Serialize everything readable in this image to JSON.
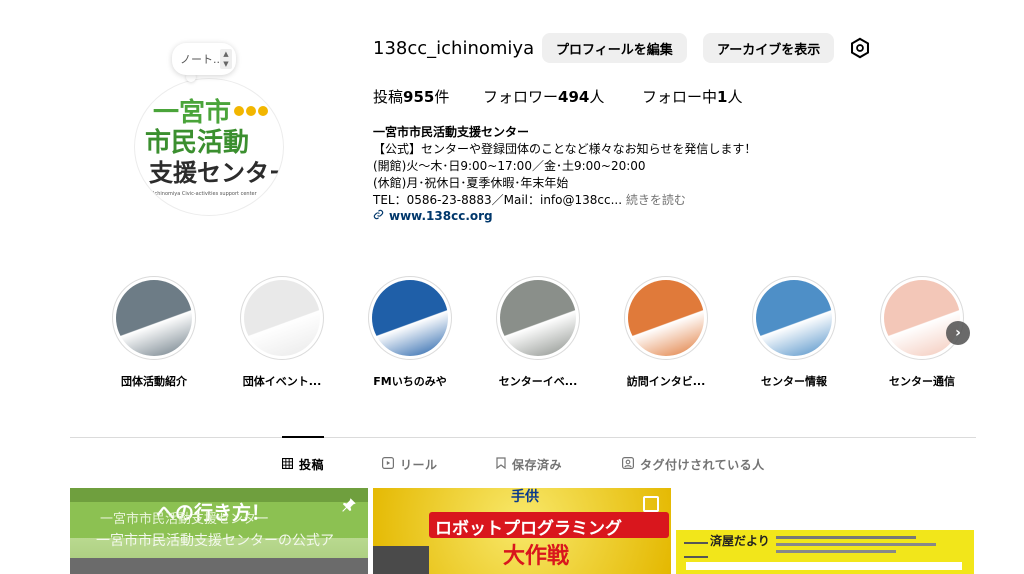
{
  "profile": {
    "username": "138cc_ichinomiya",
    "edit_profile_label": "プロフィールを編集",
    "archive_label": "アーカイブを表示",
    "note_text": "ノート...",
    "avatar_logo_lines": [
      "一宮市",
      "市民活動",
      "支援センター"
    ],
    "avatar_logo_caption": "Ichinomiya Civic-activities support center"
  },
  "stats": {
    "posts_label": "投稿",
    "posts_count": "955",
    "posts_suffix": "件",
    "followers_label": "フォロワー",
    "followers_count": "494",
    "followers_suffix": "人",
    "following_label": "フォロー中",
    "following_count": "1",
    "following_suffix": "人"
  },
  "bio": {
    "name": "一宮市市民活動支援センター",
    "line1": "【公式】センターや登録団体のことなど様々なお知らせを発信します！",
    "line2": "(開館)火～木･日9:00~17:00／金･土9:00~20:00",
    "line3": "(休館)月･祝休日･夏季休暇･年末年始",
    "line4": "TEL：0586-23-8883／Mail：info@138cc...",
    "more": "続きを読む",
    "link": "www.138cc.org"
  },
  "highlights": [
    {
      "label": "団体活動紹介",
      "color": "#6d7c86"
    },
    {
      "label": "団体イベント...",
      "color": "#e9e9e9"
    },
    {
      "label": "FMいちのみや",
      "color": "#1f5fa8"
    },
    {
      "label": "センターイベ...",
      "color": "#8a8f8a"
    },
    {
      "label": "訪問インタビ...",
      "color": "#e07a3a"
    },
    {
      "label": "センター情報",
      "color": "#4e8fc7"
    },
    {
      "label": "センター通信",
      "color": "#f3c7b8"
    }
  ],
  "tabs": [
    {
      "label": "投稿",
      "icon": "grid-icon"
    },
    {
      "label": "リール",
      "icon": "reels-icon"
    },
    {
      "label": "保存済み",
      "icon": "bookmark-icon"
    },
    {
      "label": "タグ付けされている人",
      "icon": "tagged-icon"
    }
  ],
  "posts": [
    {
      "title": "への行き方！",
      "subtitle": "一宮市市民活動支援センター",
      "overlay": "一宮市市民活動支援センターの公式ア"
    },
    {
      "title": "ロボットプログラミング",
      "subtitle": "大作戦",
      "badge": "手供"
    },
    {
      "title": "済屋だより"
    }
  ],
  "colors": {
    "link": "#00376b",
    "secondary_text": "#737373",
    "button_bg": "#efefef",
    "post1_bg": "#8cc152",
    "post2_bg": "#f5d90a",
    "post3_bg": "#f2e61a"
  }
}
